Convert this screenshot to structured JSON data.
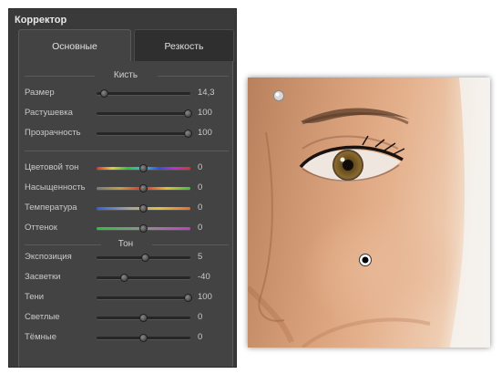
{
  "panel": {
    "title": "Корректор",
    "tabs": [
      {
        "label": "Основные",
        "active": true
      },
      {
        "label": "Резкость",
        "active": false
      }
    ],
    "sections": {
      "brush": "Кисть",
      "tone": "Тон"
    },
    "brush_controls": [
      {
        "label": "Размер",
        "value": "14,3",
        "position": 0.08,
        "track": "plain"
      },
      {
        "label": "Растушевка",
        "value": "100",
        "position": 0.98,
        "track": "plain"
      },
      {
        "label": "Прозрачность",
        "value": "100",
        "position": 0.98,
        "track": "plain"
      }
    ],
    "color_controls": [
      {
        "label": "Цветовой тон",
        "value": "0",
        "position": 0.5,
        "track": "hue"
      },
      {
        "label": "Насыщенность",
        "value": "0",
        "position": 0.5,
        "track": "saturation"
      },
      {
        "label": "Температура",
        "value": "0",
        "position": 0.5,
        "track": "temperature"
      },
      {
        "label": "Оттенок",
        "value": "0",
        "position": 0.5,
        "track": "tint"
      }
    ],
    "tone_controls": [
      {
        "label": "Экспозиция",
        "value": "5",
        "position": 0.52,
        "track": "plain"
      },
      {
        "label": "Засветки",
        "value": "-40",
        "position": 0.3,
        "track": "plain"
      },
      {
        "label": "Тени",
        "value": "100",
        "position": 0.98,
        "track": "plain"
      },
      {
        "label": "Светлые",
        "value": "0",
        "position": 0.5,
        "track": "plain"
      },
      {
        "label": "Тёмные",
        "value": "0",
        "position": 0.5,
        "track": "plain"
      }
    ]
  },
  "canvas": {
    "markers": [
      "inactive-brush-pin",
      "active-brush-pin"
    ]
  },
  "colors": {
    "panel_bg": "#3a3a3a",
    "content_bg": "#434343",
    "text": "#c9c9c9"
  }
}
